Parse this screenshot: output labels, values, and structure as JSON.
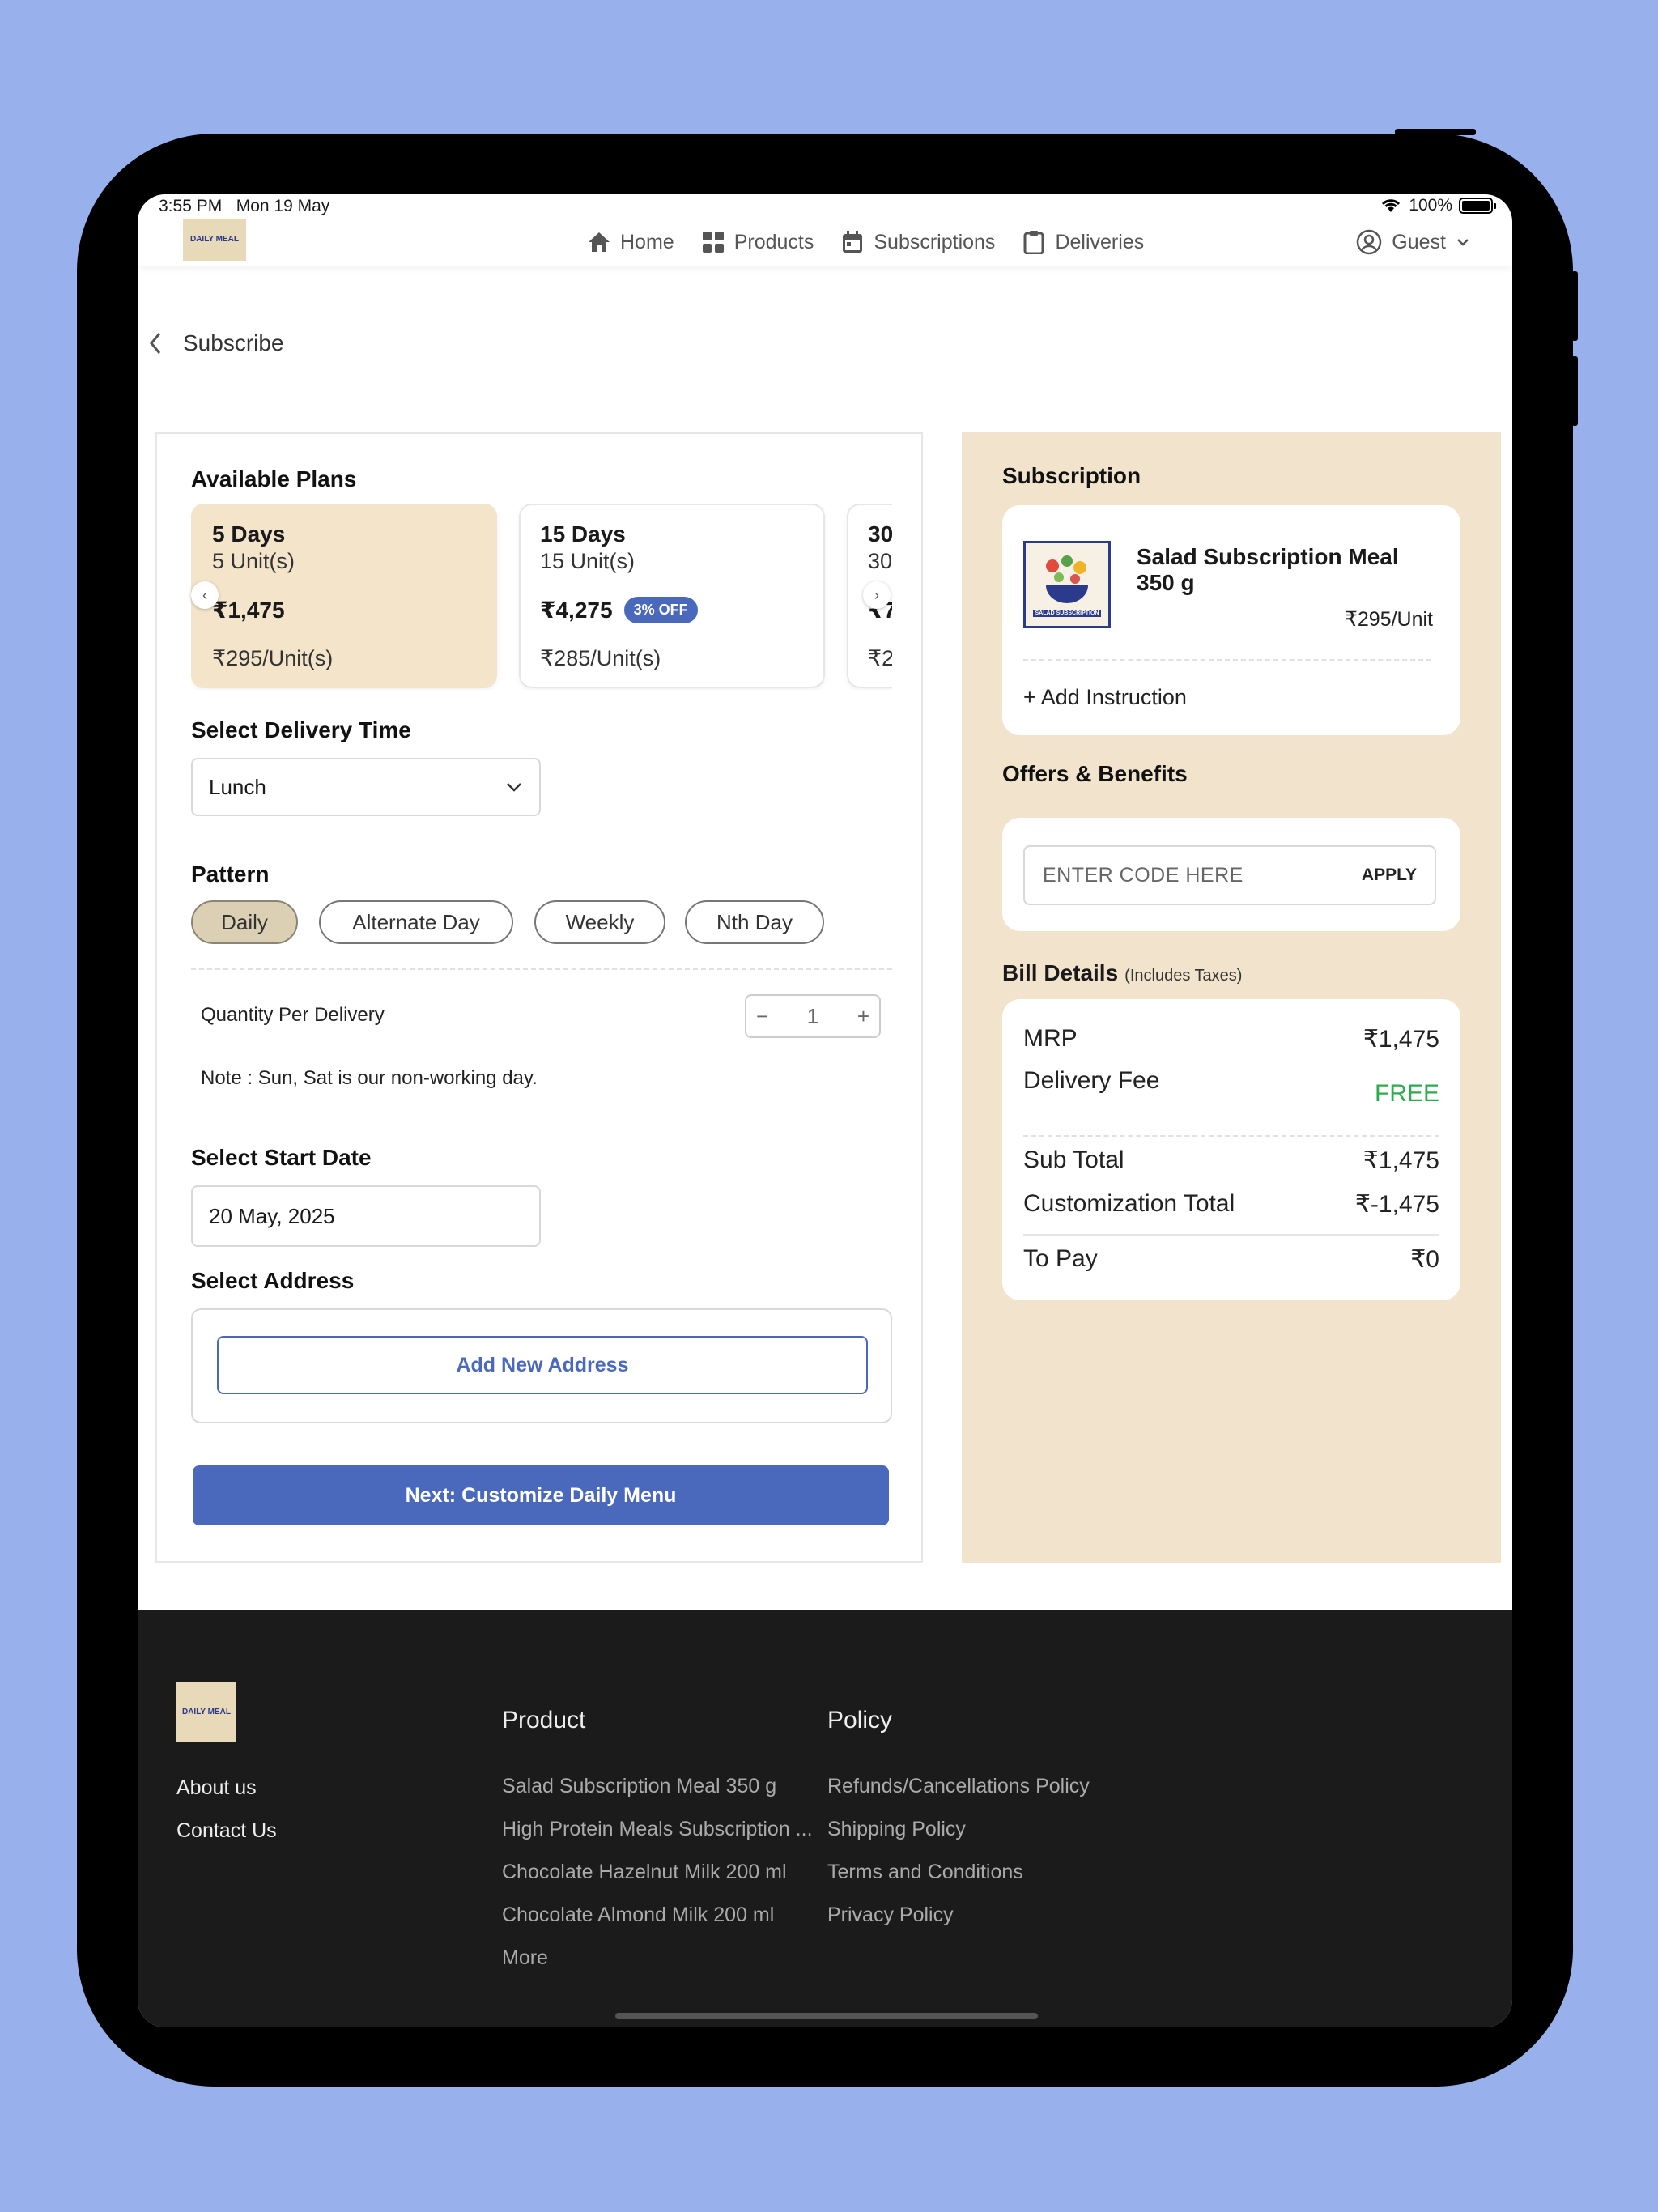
{
  "status_bar": {
    "time": "3:55 PM",
    "date": "Mon 19 May",
    "battery": "100%"
  },
  "logo": {
    "text": "DAILY MEAL"
  },
  "nav": {
    "items": [
      {
        "label": "Home",
        "icon": "home-icon"
      },
      {
        "label": "Products",
        "icon": "grid-icon"
      },
      {
        "label": "Subscriptions",
        "icon": "calendar-icon"
      },
      {
        "label": "Deliveries",
        "icon": "clipboard-icon"
      }
    ],
    "user": "Guest"
  },
  "page": {
    "title": "Subscribe"
  },
  "plans": {
    "heading": "Available Plans",
    "items": [
      {
        "days": "5 Days",
        "units": "5 Unit(s)",
        "price": "₹1,475",
        "per_unit": "₹295/Unit(s)",
        "badge": ""
      },
      {
        "days": "15 Days",
        "units": "15 Unit(s)",
        "price": "₹4,275",
        "per_unit": "₹285/Unit(s)",
        "badge": "3% OFF"
      },
      {
        "days": "30",
        "units": "30",
        "price": "₹7",
        "per_unit": "₹2"
      }
    ]
  },
  "delivery_time": {
    "heading": "Select Delivery Time",
    "value": "Lunch"
  },
  "pattern": {
    "heading": "Pattern",
    "options": [
      "Daily",
      "Alternate Day",
      "Weekly",
      "Nth Day"
    ]
  },
  "quantity": {
    "label": "Quantity Per Delivery",
    "value": "1"
  },
  "note": "Note : Sun, Sat is our non-working day.",
  "start_date": {
    "heading": "Select Start Date",
    "value": "20 May, 2025"
  },
  "address": {
    "heading": "Select Address",
    "add_label": "Add New Address"
  },
  "next_button": "Next: Customize Daily Menu",
  "subscription": {
    "heading": "Subscription",
    "product_name": "Salad Subscription Meal 350 g",
    "price": "₹295/Unit",
    "image_caption": "SALAD SUBSCRIPTION",
    "add_instruction": "+ Add Instruction"
  },
  "offers": {
    "heading": "Offers & Benefits",
    "placeholder": "ENTER CODE HERE",
    "apply": "APPLY"
  },
  "bill": {
    "heading": "Bill Details",
    "subheading": "(Includes Taxes)",
    "mrp_label": "MRP",
    "mrp": "₹1,475",
    "delivery_label": "Delivery Fee",
    "delivery": "FREE",
    "subtotal_label": "Sub Total",
    "subtotal": "₹1,475",
    "custom_label": "Customization Total",
    "custom": "₹-1,475",
    "topay_label": "To Pay",
    "topay": "₹0"
  },
  "footer": {
    "company_links": [
      "About us",
      "Contact Us"
    ],
    "product_heading": "Product",
    "product_links": [
      "Salad Subscription Meal 350 g",
      "High Protein Meals Subscription ...",
      "Chocolate Hazelnut Milk 200 ml",
      "Chocolate Almond Milk 200 ml",
      "More"
    ],
    "policy_heading": "Policy",
    "policy_links": [
      "Refunds/Cancellations Policy",
      "Shipping Policy",
      "Terms and Conditions",
      "Privacy Policy"
    ]
  },
  "colors": {
    "accent": "#4a69bd",
    "panel": "#f2e4cc",
    "free": "#2eaa4f",
    "footer": "#1b1b1b"
  }
}
